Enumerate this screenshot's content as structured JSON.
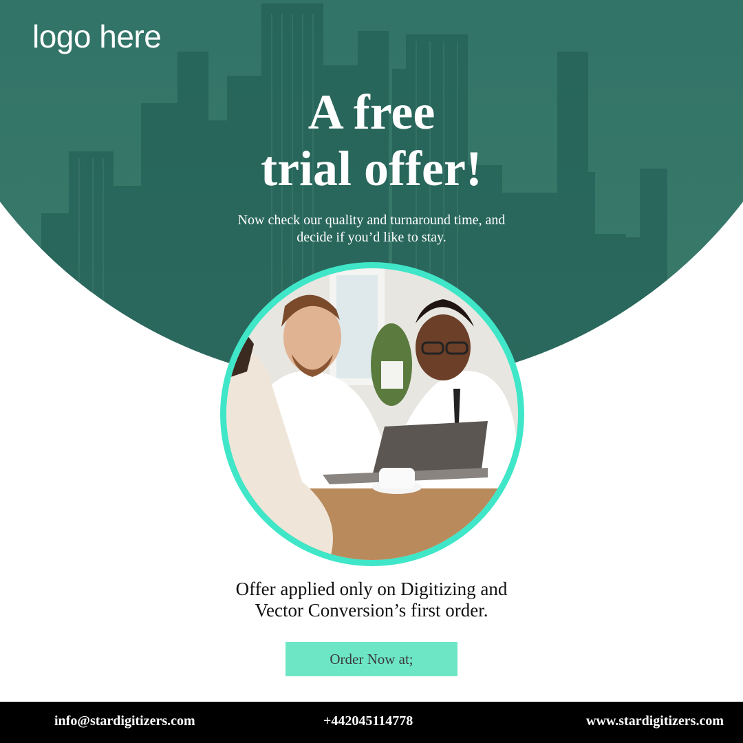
{
  "brand": {
    "logo_text": "logo here"
  },
  "hero": {
    "headline_line1": "A free",
    "headline_line2": "trial offer!",
    "subtext_line1": "Now check our quality and turnaround time, and",
    "subtext_line2": "decide if you’d like to stay."
  },
  "offer": {
    "line1": "Offer applied only on Digitizing and",
    "line2": "Vector Conversion’s first order."
  },
  "cta": {
    "label": "Order Now at;"
  },
  "footer": {
    "email": "info@stardigitizers.com",
    "phone": "+442045114778",
    "website": "www.stardigitizers.com"
  },
  "colors": {
    "hero_teal": "#2e6e62",
    "accent_ring": "#3fe6c8",
    "cta_bg": "#6de6c6",
    "footer_bg": "#000000"
  }
}
